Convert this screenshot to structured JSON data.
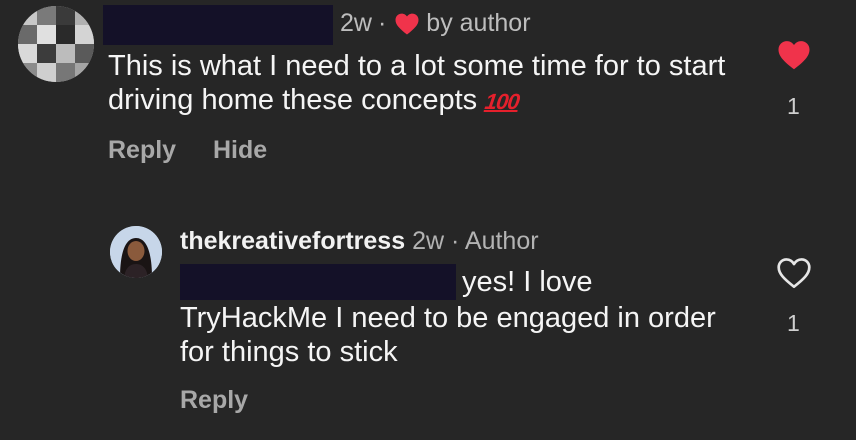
{
  "colors": {
    "background": "#262626",
    "text": "#f5f5f5",
    "muted": "#a8a8a8",
    "like_red": "#f0334b",
    "redaction": "#141128"
  },
  "comments": [
    {
      "time": "2w",
      "separator": "·",
      "liked_by_label": "by author",
      "text": "This is what I need to a lot some time for to start driving home these concepts",
      "emoji": "100",
      "reply_label": "Reply",
      "hide_label": "Hide",
      "like_icon": "heart-filled-icon",
      "like_count": "1"
    },
    {
      "username": "thekreativefortress",
      "time": "2w",
      "separator": "·",
      "role": "Author",
      "text_line1": "yes! I love",
      "text_rest": "TryHackMe I need to be engaged in order for things to stick",
      "reply_label": "Reply",
      "like_icon": "heart-outline-icon",
      "like_count": "1"
    }
  ]
}
